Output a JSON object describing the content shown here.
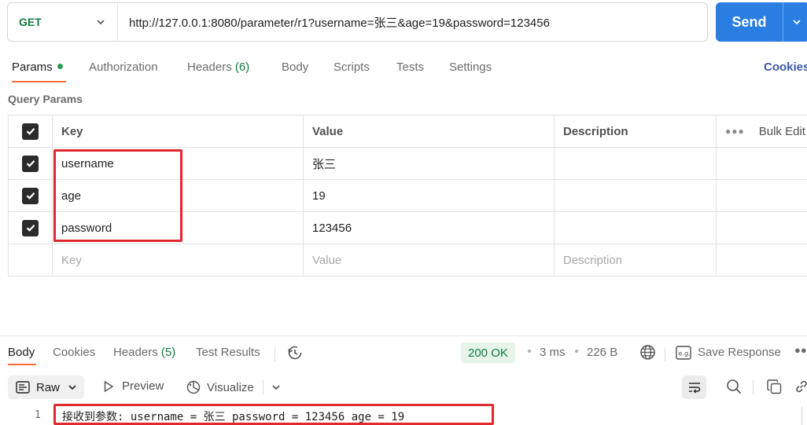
{
  "request": {
    "method": "GET",
    "url": "http://127.0.0.1:8080/parameter/r1?username=张三&age=19&password=123456",
    "send_label": "Send"
  },
  "tabs": {
    "params": "Params",
    "authorization": "Authorization",
    "headers": "Headers",
    "headers_count": "(6)",
    "body": "Body",
    "scripts": "Scripts",
    "tests": "Tests",
    "settings": "Settings",
    "cookies": "Cookies"
  },
  "query_params": {
    "title": "Query Params",
    "columns": {
      "key": "Key",
      "value": "Value",
      "description": "Description",
      "bulk_edit": "Bulk Edit"
    },
    "rows": [
      {
        "key": "username",
        "value": "张三",
        "description": "",
        "checked": true
      },
      {
        "key": "age",
        "value": "19",
        "description": "",
        "checked": true
      },
      {
        "key": "password",
        "value": "123456",
        "description": "",
        "checked": true
      }
    ],
    "placeholders": {
      "key": "Key",
      "value": "Value",
      "description": "Description"
    }
  },
  "response": {
    "tabs": {
      "body": "Body",
      "cookies": "Cookies",
      "headers": "Headers",
      "headers_count": "(5)",
      "test_results": "Test Results"
    },
    "status": "200 OK",
    "time": "3 ms",
    "size": "226 B",
    "save_response": "Save Response",
    "format": "Raw",
    "preview": "Preview",
    "visualize": "Visualize",
    "lines": [
      {
        "number": "1",
        "text": "接收到参数: username = 张三 password = 123456 age = 19"
      }
    ]
  },
  "colors": {
    "accent_orange": "#ff6c37",
    "send_blue": "#2a7de1",
    "method_green": "#0f7b3e",
    "highlight_red": "#e0282d"
  }
}
